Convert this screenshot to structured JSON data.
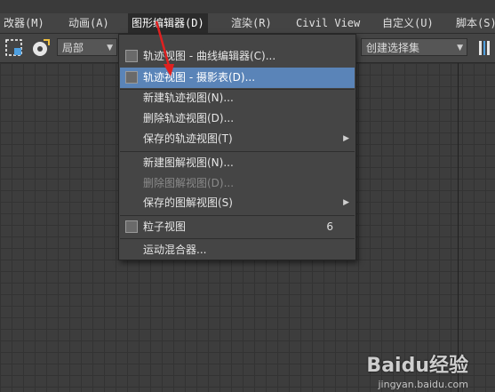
{
  "menubar": {
    "items": [
      {
        "label": "改器(M)"
      },
      {
        "label": "动画(A)"
      },
      {
        "label": "图形编辑器(D)"
      },
      {
        "label": "渲染(R)"
      },
      {
        "label": "Civil View"
      },
      {
        "label": "自定义(U)"
      },
      {
        "label": "脚本(S)"
      }
    ]
  },
  "toolbar": {
    "coord_dropdown": "局部",
    "selection_set_dropdown": "创建选择集"
  },
  "popup_menu": {
    "items": [
      {
        "label": "轨迹视图 - 曲线编辑器(C)...",
        "icon": "curve-editor-icon"
      },
      {
        "label": "轨迹视图 - 摄影表(D)...",
        "icon": "dope-sheet-icon",
        "highlighted": true
      },
      {
        "label": "新建轨迹视图(N)..."
      },
      {
        "label": "删除轨迹视图(D)..."
      },
      {
        "label": "保存的轨迹视图(T)",
        "submenu": true
      },
      {
        "label": "新建图解视图(N)..."
      },
      {
        "label": "删除图解视图(D)...",
        "disabled": true
      },
      {
        "label": "保存的图解视图(S)",
        "submenu": true
      },
      {
        "label": "粒子视图",
        "icon": "particle-view-icon",
        "shortcut": "6"
      },
      {
        "label": "运动混合器..."
      }
    ]
  },
  "watermark": {
    "text": "Baidu经验",
    "sub": "jingyan.baidu.com"
  },
  "colors": {
    "highlight": "#5a84b8",
    "menu_bg": "#454545",
    "viewport_bg": "#3d3d3d",
    "arrow": "#e02020"
  }
}
